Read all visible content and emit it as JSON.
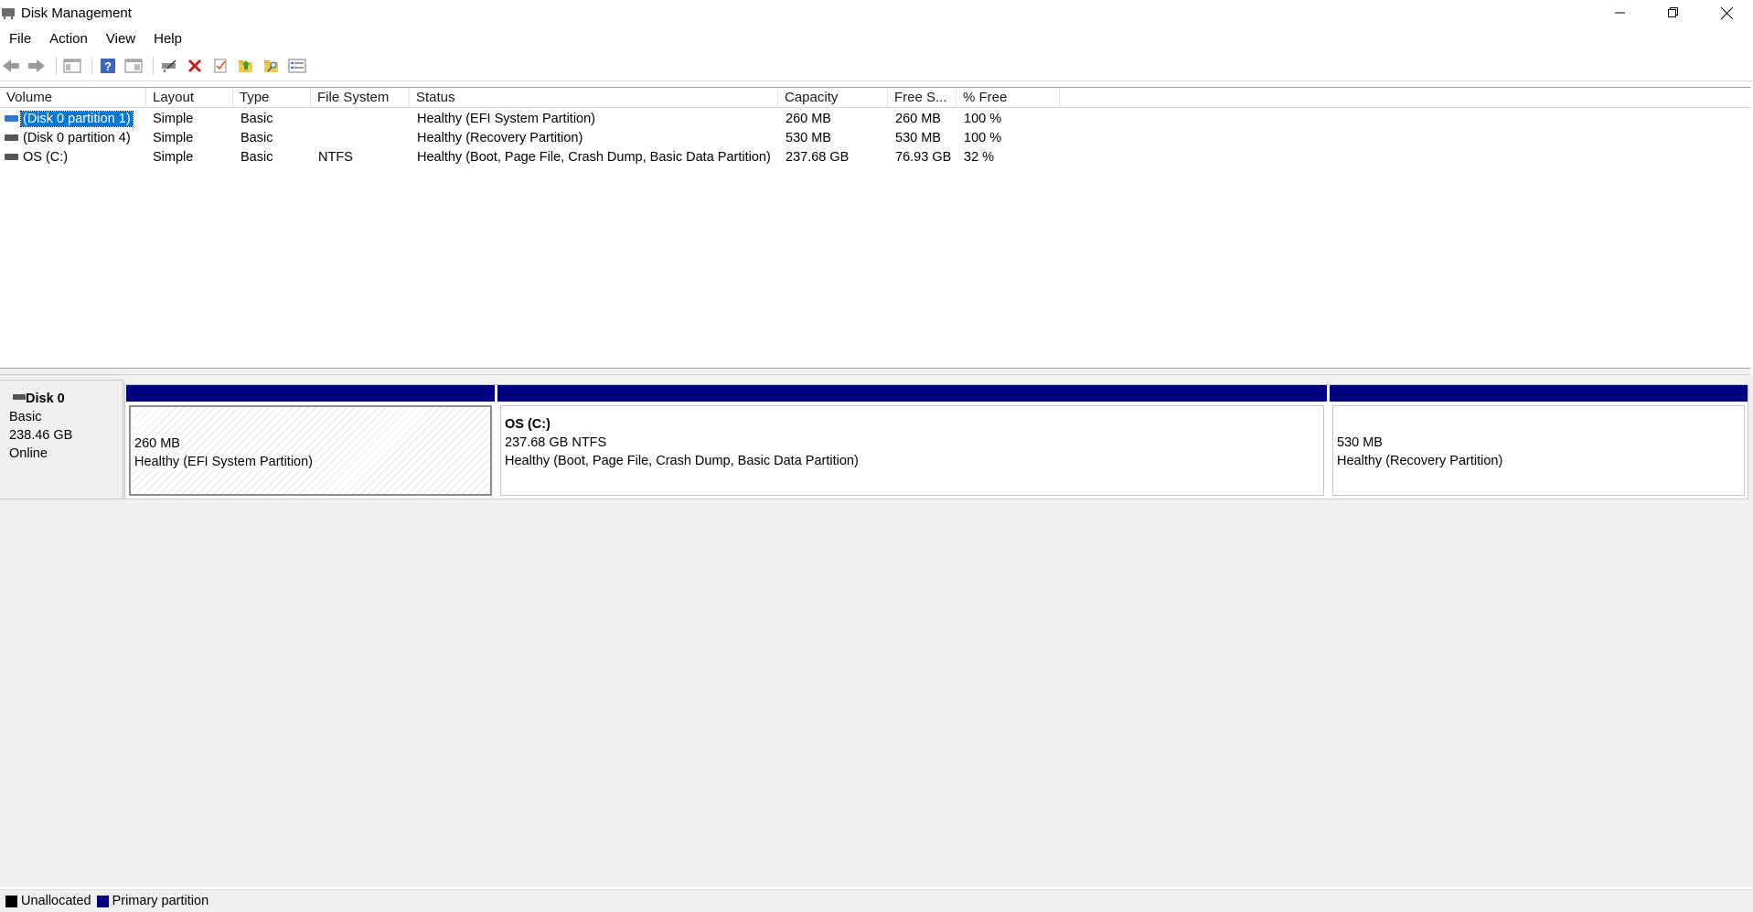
{
  "window": {
    "title": "Disk Management"
  },
  "menu": {
    "items": [
      "File",
      "Action",
      "View",
      "Help"
    ]
  },
  "toolbar": {
    "buttons": [
      "back-icon",
      "forward-icon",
      "show-hide-console-tree-icon",
      "help-icon",
      "properties-icon",
      "connect-disk-icon",
      "delete-icon",
      "check-icon",
      "folder-up-icon",
      "folder-search-icon",
      "view-list-icon"
    ]
  },
  "volume_list": {
    "columns": [
      "Volume",
      "Layout",
      "Type",
      "File System",
      "Status",
      "Capacity",
      "Free S...",
      "% Free"
    ],
    "rows": [
      {
        "volume": "(Disk 0 partition 1)",
        "layout": "Simple",
        "type": "Basic",
        "fs": "",
        "status": "Healthy (EFI System Partition)",
        "capacity": "260 MB",
        "free": "260 MB",
        "pct": "100 %",
        "selected": true
      },
      {
        "volume": "(Disk 0 partition 4)",
        "layout": "Simple",
        "type": "Basic",
        "fs": "",
        "status": "Healthy (Recovery Partition)",
        "capacity": "530 MB",
        "free": "530 MB",
        "pct": "100 %",
        "selected": false
      },
      {
        "volume": "OS (C:)",
        "layout": "Simple",
        "type": "Basic",
        "fs": "NTFS",
        "status": "Healthy (Boot, Page File, Crash Dump, Basic Data Partition)",
        "capacity": "237.68 GB",
        "free": "76.93 GB",
        "pct": "32 %",
        "selected": false
      }
    ]
  },
  "disk": {
    "name": "Disk 0",
    "type": "Basic",
    "size": "238.46 GB",
    "state": "Online",
    "partitions": [
      {
        "name": "",
        "size": "260 MB",
        "status": "Healthy (EFI System Partition)",
        "selected": true
      },
      {
        "name": "OS  (C:)",
        "size": "237.68 GB NTFS",
        "status": "Healthy (Boot, Page File, Crash Dump, Basic Data Partition)",
        "selected": false
      },
      {
        "name": "",
        "size": "530 MB",
        "status": "Healthy (Recovery Partition)",
        "selected": false
      }
    ]
  },
  "legend": {
    "unallocated": "Unallocated",
    "primary": "Primary partition",
    "colors": {
      "unallocated": "#000000",
      "primary": "#000080"
    }
  }
}
